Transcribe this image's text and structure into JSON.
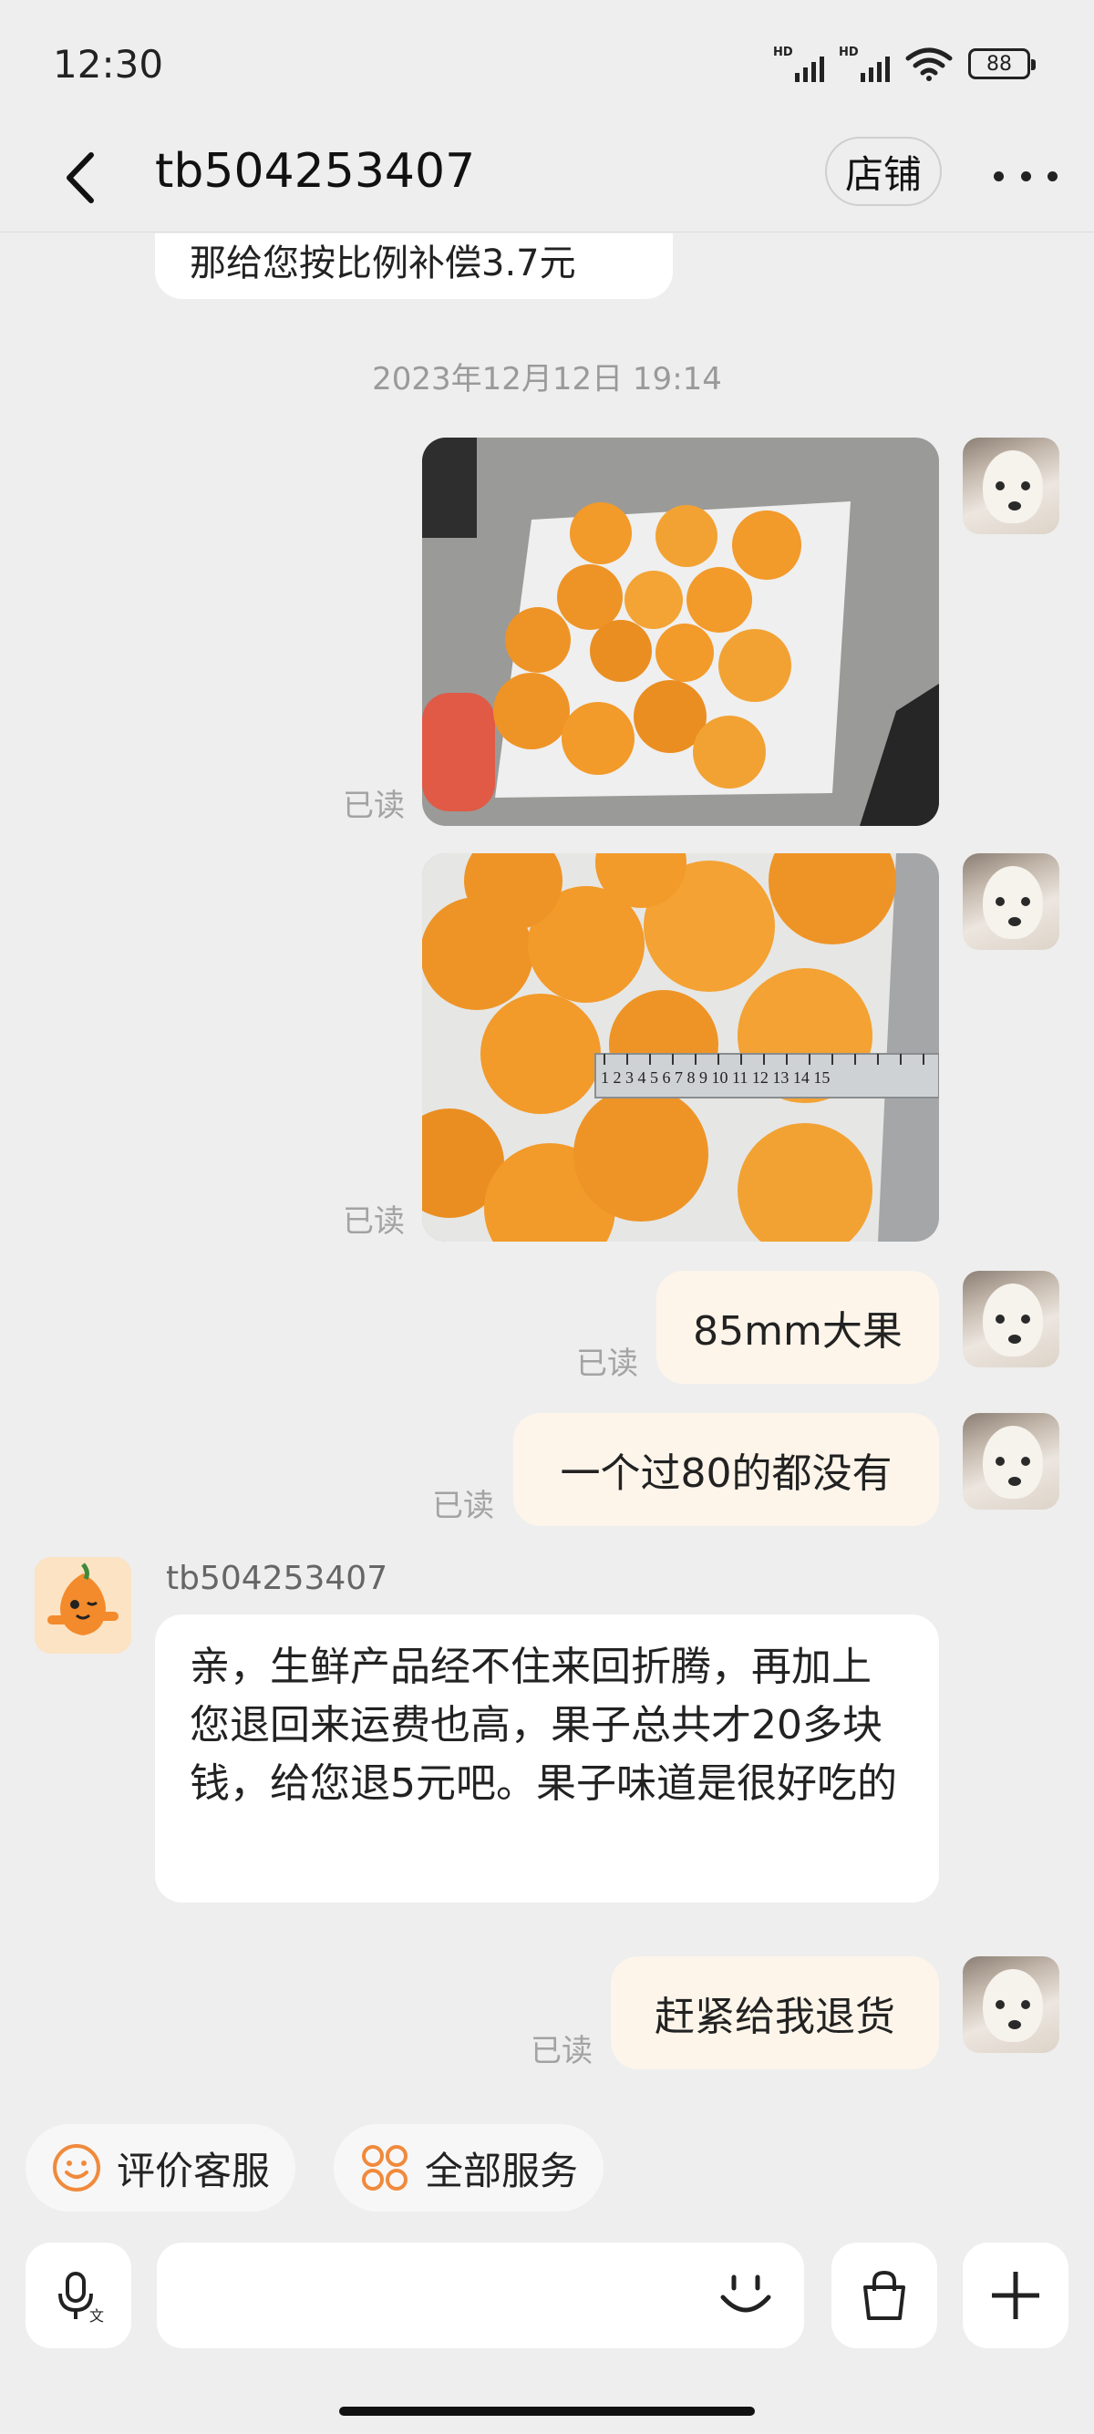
{
  "status_bar": {
    "time": "12:30",
    "signal_label_1": "HD",
    "signal_label_2": "HD",
    "battery": "88"
  },
  "nav": {
    "title": "tb504253407",
    "shop_label": "店铺"
  },
  "chat": {
    "prev_message_tail": "那给您按比例补偿3.7元",
    "timestamp": "2023年12月12日 19:14",
    "read_label": "已读",
    "messages_me": [
      {
        "text": "85mm大果"
      },
      {
        "text": "一个过80的都没有"
      },
      {
        "text": "赶紧给我退货"
      }
    ],
    "shop_name": "tb504253407",
    "shop_message": "亲，生鲜产品经不住来回折腾，再加上您退回来运费也高，果子总共才20多块钱，给您退5元吧。果子味道是很好吃的",
    "ruler_text": "1 2 3 4 5 6 7 8 9 10 11 12 13 14 15"
  },
  "quick_actions": [
    {
      "label": "评价客服",
      "icon": "smile-icon"
    },
    {
      "label": "全部服务",
      "icon": "grid-icon"
    }
  ],
  "input_bar": {
    "placeholder": "",
    "voice_icon": "microphone-icon",
    "emoji_icon": "emoji-icon",
    "bag_icon": "shopping-bag-icon",
    "plus_icon": "plus-icon"
  },
  "colors": {
    "background": "#eeeeee",
    "my_bubble": "#fdf5ea",
    "shop_bubble": "#ffffff",
    "accent_orange": "#f08a3c"
  }
}
